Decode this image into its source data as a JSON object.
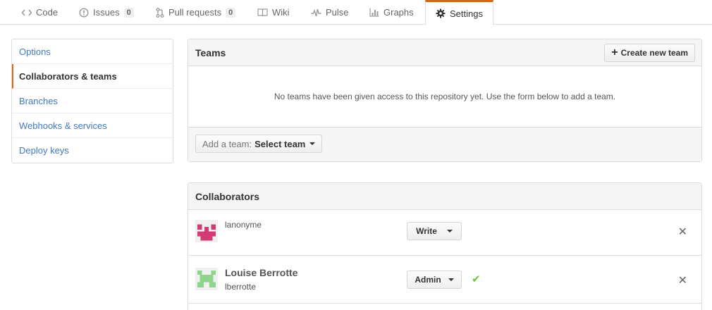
{
  "tabs": [
    {
      "label": "Code",
      "icon": "code-icon"
    },
    {
      "label": "Issues",
      "icon": "issue-icon",
      "count": "0"
    },
    {
      "label": "Pull requests",
      "icon": "pull-request-icon",
      "count": "0"
    },
    {
      "label": "Wiki",
      "icon": "book-icon"
    },
    {
      "label": "Pulse",
      "icon": "pulse-icon"
    },
    {
      "label": "Graphs",
      "icon": "graph-icon"
    },
    {
      "label": "Settings",
      "icon": "gear-icon",
      "selected": true
    }
  ],
  "menu": [
    {
      "label": "Options"
    },
    {
      "label": "Collaborators & teams",
      "selected": true
    },
    {
      "label": "Branches"
    },
    {
      "label": "Webhooks & services"
    },
    {
      "label": "Deploy keys"
    }
  ],
  "teams": {
    "title": "Teams",
    "create_label": "Create new team",
    "blank": "No teams have been given access to this repository yet. Use the form below to add a team.",
    "select_prefix": "Add a team:",
    "select_value": "Select team"
  },
  "collaborators": {
    "title": "Collaborators",
    "rows": [
      {
        "login": "lanonyme",
        "permission": "Write"
      },
      {
        "name": "Louise Berrotte",
        "login": "lberrotte",
        "permission": "Admin"
      }
    ]
  },
  "colors": {
    "accent": "#d26911",
    "link": "#4078c0",
    "success": "#6cc644"
  }
}
